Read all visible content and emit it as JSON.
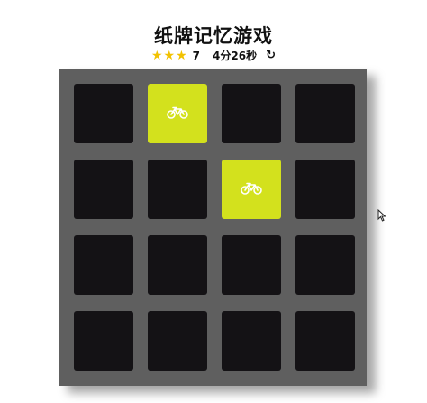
{
  "game": {
    "title": "纸牌记忆游戏",
    "moves": "7",
    "timer": "4分26秒",
    "star_count": 3,
    "restart_icon": "↻"
  },
  "colors": {
    "deck": "#5f5f5f",
    "card_back": "#141215",
    "card_open": "#d3e11d",
    "star": "#f2c200"
  },
  "cards": [
    {
      "state": "closed",
      "icon": "bicycle-icon"
    },
    {
      "state": "open",
      "icon": "bicycle-icon"
    },
    {
      "state": "closed",
      "icon": ""
    },
    {
      "state": "closed",
      "icon": ""
    },
    {
      "state": "closed",
      "icon": ""
    },
    {
      "state": "closed",
      "icon": ""
    },
    {
      "state": "open",
      "icon": "bicycle-icon"
    },
    {
      "state": "closed",
      "icon": ""
    },
    {
      "state": "closed",
      "icon": ""
    },
    {
      "state": "closed",
      "icon": ""
    },
    {
      "state": "closed",
      "icon": ""
    },
    {
      "state": "closed",
      "icon": ""
    },
    {
      "state": "closed",
      "icon": ""
    },
    {
      "state": "closed",
      "icon": ""
    },
    {
      "state": "closed",
      "icon": ""
    },
    {
      "state": "closed",
      "icon": ""
    }
  ]
}
